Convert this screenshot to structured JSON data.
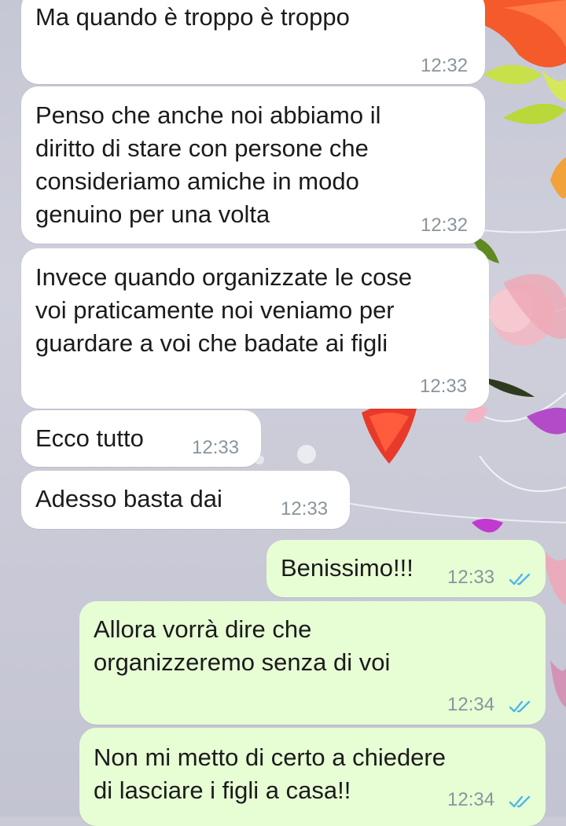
{
  "chat": {
    "messages": [
      {
        "direction": "incoming",
        "text_lines": [
          "Ma quando è troppo è troppo"
        ],
        "time": "12:32"
      },
      {
        "direction": "incoming",
        "text_lines": [
          "Penso che anche noi abbiamo il",
          "diritto di stare con persone che",
          "consideriamo amiche in modo",
          "genuino per una volta"
        ],
        "time": "12:32"
      },
      {
        "direction": "incoming",
        "text_lines": [
          "Invece quando organizzate le cose",
          "voi praticamente noi veniamo per",
          "guardare a voi che badate ai figli"
        ],
        "time": "12:33"
      },
      {
        "direction": "incoming",
        "text_lines": [
          "Ecco tutto"
        ],
        "time": "12:33"
      },
      {
        "direction": "incoming",
        "text_lines": [
          "Adesso basta dai"
        ],
        "time": "12:33"
      },
      {
        "direction": "outgoing",
        "text_lines": [
          "Benissimo!!!"
        ],
        "time": "12:33",
        "status": "read"
      },
      {
        "direction": "outgoing",
        "text_lines": [
          "Allora vorrà dire che",
          "organizzeremo senza di voi"
        ],
        "time": "12:34",
        "status": "read"
      },
      {
        "direction": "outgoing",
        "text_lines": [
          "Non mi metto di certo a chiedere",
          "di lasciare i figli a casa!!"
        ],
        "time": "12:34",
        "status": "read"
      }
    ]
  },
  "colors": {
    "incoming_bubble": "#ffffff",
    "outgoing_bubble": "#e7fed5",
    "timestamp": "#8a949c",
    "read_ticks": "#4fb6ec",
    "wallpaper": "#c9cad6"
  },
  "icons": {
    "read_receipt": "double-check-icon"
  }
}
